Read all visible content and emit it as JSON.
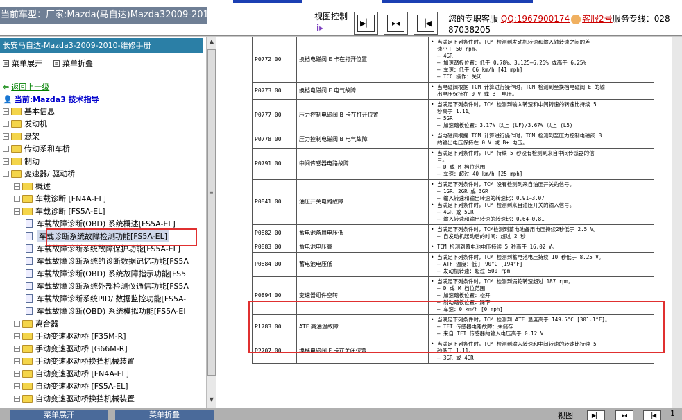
{
  "header": {
    "vehicle": "当前车型：厂家:Mazda(马自达)Mazda32009-2010",
    "view_control": "视图控制",
    "view_logo": "ⅰ▸",
    "nav_icons": [
      "next-page-icon",
      "fit-page-icon",
      "prev-page-icon"
    ],
    "service_prefix": "您的专职客服",
    "qq": "QQ:1967900174",
    "kf": "客服2号",
    "hotline_label": "服务专线：028-",
    "hotline_num": "87038205"
  },
  "sidebar": {
    "manual_title": "长安马自达-Mazda3-2009-2010-维修手册",
    "expand_label": "菜单展开",
    "collapse_label": "菜单折叠",
    "back_label": "返回上一级",
    "current_label": "当前:Mazda3 技术指导",
    "tree": [
      {
        "label": "基本信息",
        "level": 0,
        "type": "folder",
        "exp": "+"
      },
      {
        "label": "发动机",
        "level": 0,
        "type": "folder",
        "exp": "+"
      },
      {
        "label": "悬架",
        "level": 0,
        "type": "folder",
        "exp": "+"
      },
      {
        "label": "传动系和车桥",
        "level": 0,
        "type": "folder",
        "exp": "+"
      },
      {
        "label": "制动",
        "level": 0,
        "type": "folder",
        "exp": "+"
      },
      {
        "label": "变速器/ 驱动桥",
        "level": 0,
        "type": "folder",
        "exp": "−"
      },
      {
        "label": "概述",
        "level": 1,
        "type": "folder",
        "exp": "+"
      },
      {
        "label": "车载诊断 [FN4A-EL]",
        "level": 1,
        "type": "folder",
        "exp": "+"
      },
      {
        "label": "车载诊断 [FS5A-EL]",
        "level": 1,
        "type": "folder",
        "exp": "−"
      },
      {
        "label": "车载故障诊断(OBD) 系统概述[FS5A-EL]",
        "level": 2,
        "type": "doc"
      },
      {
        "label": "车载诊断系统故障检测功能[FS5A-EL]",
        "level": 2,
        "type": "doc",
        "selected": true
      },
      {
        "label": "车载故障诊断系统故障保护功能[FS5A-EL]",
        "level": 2,
        "type": "doc"
      },
      {
        "label": "车载故障诊断系统的诊断数据记忆功能[FS5A",
        "level": 2,
        "type": "doc"
      },
      {
        "label": "车载故障诊断(OBD) 系统故障指示功能[FS5",
        "level": 2,
        "type": "doc"
      },
      {
        "label": "车载故障诊断系统外部检测仪通信功能[FS5A",
        "level": 2,
        "type": "doc"
      },
      {
        "label": "车载故障诊断系统PID/ 数据监控功能[FS5A-",
        "level": 2,
        "type": "doc"
      },
      {
        "label": "车载故障诊断(OBD) 系统模拟功能[FS5A-EI",
        "level": 2,
        "type": "doc"
      },
      {
        "label": "离合器",
        "level": 1,
        "type": "folder",
        "exp": "+"
      },
      {
        "label": "手动变速驱动桥 [F35M-R]",
        "level": 1,
        "type": "folder",
        "exp": "+"
      },
      {
        "label": "手动变速驱动桥 [G66M-R]",
        "level": 1,
        "type": "folder",
        "exp": "+"
      },
      {
        "label": "手动变速驱动桥换挡机械装置",
        "level": 1,
        "type": "folder",
        "exp": "+"
      },
      {
        "label": "自动变速驱动桥 [FN4A-EL]",
        "level": 1,
        "type": "folder",
        "exp": "+"
      },
      {
        "label": "自动变速驱动桥 [FS5A-EL]",
        "level": 1,
        "type": "folder",
        "exp": "+"
      },
      {
        "label": "自动变速驱动桥换挡机械装置",
        "level": 1,
        "type": "folder",
        "exp": "+"
      }
    ]
  },
  "table": {
    "rows": [
      {
        "code": "P0772:00",
        "name": "换档电磁阀 E 卡在打开位置",
        "cond": [
          [
            "b",
            "• 当满足下列条件时，TCM 检测到发动机转速和输入轴转速之间的差"
          ],
          [
            "s",
            "速小于 50 rpm。"
          ],
          [
            "s",
            "— 4GR"
          ],
          [
            "s",
            "— 加速踏板位置：低于 0.78%、3.125—6.25% 或高于 6.25%"
          ],
          [
            "s",
            "— 车速：低于 66 km/h [41 mph]"
          ],
          [
            "s",
            "— TCC 操作：关闭"
          ]
        ]
      },
      {
        "code": "P0773:00",
        "name": "换档电磁阀 E 电气故障",
        "cond": [
          [
            "b",
            "• 当电磁阀根据 TCM 计算进行操作时，TCM 检测到至换档电磁阀 E 的输"
          ],
          [
            "s",
            "出电压保持在 0 V 或 B+ 电压。"
          ]
        ]
      },
      {
        "code": "P0777:00",
        "name": "压力控制电磁阀 B 卡在打开位置",
        "cond": [
          [
            "b",
            "• 当满足下列条件时，TCM 检测到输入转速和中间转速的转速比持续 5"
          ],
          [
            "s",
            "秒高于 1.11。"
          ],
          [
            "s",
            "— 5GR"
          ],
          [
            "s",
            "— 加速踏板位置：3.17% 以上 (LF)/3.67% 以上 (L5)"
          ]
        ]
      },
      {
        "code": "P0778:00",
        "name": "压力控制电磁阀 B 电气故障",
        "cond": [
          [
            "b",
            "• 当电磁阀根据 TCM 计算进行操作时，TCM 检测到至压力控制电磁阀 B"
          ],
          [
            "s",
            "的输出电压保持在 0 V 或 B+ 电压。"
          ]
        ]
      },
      {
        "code": "P0791:00",
        "name": "中间传感器电路故障",
        "cond": [
          [
            "b",
            "• 当满足下列条件时，TCM 持续 5 秒没有检测到来自中间传感器的信"
          ],
          [
            "s",
            "号。"
          ],
          [
            "s",
            "— D 或 M 档位范围"
          ],
          [
            "s",
            "— 车速：超过 40 km/h [25 mph]"
          ]
        ]
      },
      {
        "code": "P0841:00",
        "name": "油压开关电路故障",
        "cond": [
          [
            "b",
            "• 当满足下列条件时，TCM 没有检测到来自油压开关的信号。"
          ],
          [
            "s",
            "— 1GR、2GR 或 3GR"
          ],
          [
            "s",
            "— 输入转速和输出转速的转速比：0.91—3.07"
          ],
          [
            "b",
            "• 当满足下列条件时，TCM 检测到来自油压开关的输入信号。"
          ],
          [
            "s",
            "— 4GR 或 5GR"
          ],
          [
            "s",
            "— 输入转速和输出转速的转速比：0.64—0.81"
          ]
        ]
      },
      {
        "code": "P0882:00",
        "name": "蓄电池备用电压低",
        "cond": [
          [
            "b",
            "• 当满足下列条件时，TCM检测到蓄电池备用电压持续2秒低于 2.5 V。"
          ],
          [
            "s",
            "— 自发动机起动后的时间：超过 2 秒"
          ]
        ]
      },
      {
        "code": "P0883:00",
        "name": "蓄电池电压高",
        "cond": [
          [
            "b",
            "• TCM 检测到蓄电池电压持续 5 秒高于 16.02 V。"
          ]
        ]
      },
      {
        "code": "P0884:00",
        "name": "蓄电池电压低",
        "cond": [
          [
            "b",
            "• 当满足下列条件时，TCM 检测到蓄电池电压持续 10 秒低于 8.25 V。"
          ],
          [
            "s",
            "— ATF 温度：低于 90°C [194°F]"
          ],
          [
            "s",
            "— 发动机转速：超过 500 rpm"
          ]
        ]
      },
      {
        "code": "P0894:00",
        "name": "变速器组件空转",
        "cond": [
          [
            "b",
            "• 当满足下列条件时，TCM 检测到涡轮转速超过 187 rpm。"
          ],
          [
            "s",
            "— D 或 M 档位范围"
          ],
          [
            "s",
            "— 加速踏板位置：松开"
          ],
          [
            "s",
            "— 制动踏板位置：踩下"
          ],
          [
            "s",
            "— 车速：0 km/h [0 mph]"
          ]
        ]
      },
      {
        "code": "P1783:00",
        "name": "ATF 高油温故障",
        "cond": [
          [
            "b",
            "• 当满足下列条件时，TCM 检测到 ATF 温度高于 149.5°C [301.1°F]。"
          ],
          [
            "s",
            "— TFT 传感器电路故障：未储存"
          ],
          [
            "s",
            "— 来自 TFT 传感器的输入电压高于 0.12 V"
          ]
        ]
      },
      {
        "code": "P2707:00",
        "name": "换档电磁阀 F 卡在关闭位置",
        "cond": [
          [
            "b",
            "• 当满足下列条件时，TCM 检测到输入转速和中间转速的转速比持续 5"
          ],
          [
            "s",
            "秒低于 1.11。"
          ],
          [
            "s",
            "— 3GR 或 4GR"
          ]
        ]
      }
    ]
  },
  "bottom": {
    "expand_label": "菜单展开",
    "collapse_label": "菜单折叠",
    "view_label": "视图",
    "page_number": "1"
  },
  "colors": {
    "highlight_box": "#e03030",
    "title_strip": "#6f7f95",
    "manual_title_bg": "#2b7fa6"
  }
}
